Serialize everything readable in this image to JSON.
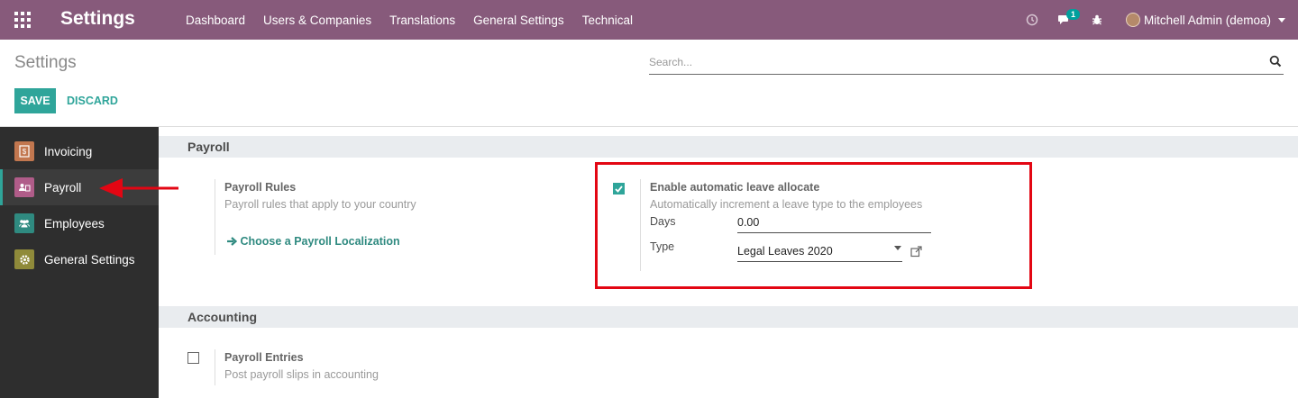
{
  "navbar": {
    "brand": "Settings",
    "menu": [
      "Dashboard",
      "Users & Companies",
      "Translations",
      "General Settings",
      "Technical"
    ],
    "messages_badge": "1",
    "user": "Mitchell Admin (demoa)"
  },
  "control_panel": {
    "title": "Settings",
    "search_placeholder": "Search...",
    "save_label": "SAVE",
    "discard_label": "DISCARD"
  },
  "sidebar": {
    "items": [
      {
        "label": "Invoicing",
        "icon": "invoice-icon",
        "color": "#c2774f"
      },
      {
        "label": "Payroll",
        "icon": "payroll-icon",
        "color": "#b05c89"
      },
      {
        "label": "Employees",
        "icon": "employees-icon",
        "color": "#2f8a80"
      },
      {
        "label": "General Settings",
        "icon": "gear-icon",
        "color": "#8f8a3a"
      }
    ],
    "active": "Payroll"
  },
  "payroll": {
    "heading": "Payroll",
    "rules": {
      "title": "Payroll Rules",
      "description": "Payroll rules that apply to your country",
      "link": "Choose a Payroll Localization"
    },
    "leave": {
      "title": "Enable automatic leave allocate",
      "description": "Automatically increment a leave type to the employees",
      "checked": true,
      "days_label": "Days",
      "days_value": "0.00",
      "type_label": "Type",
      "type_value": "Legal Leaves 2020"
    }
  },
  "accounting": {
    "heading": "Accounting",
    "entries": {
      "title": "Payroll Entries",
      "description": "Post payroll slips in accounting",
      "checked": false
    }
  },
  "colors": {
    "navbar": "#875a7b",
    "accent": "#2fa59a",
    "annotation": "#e30613"
  }
}
